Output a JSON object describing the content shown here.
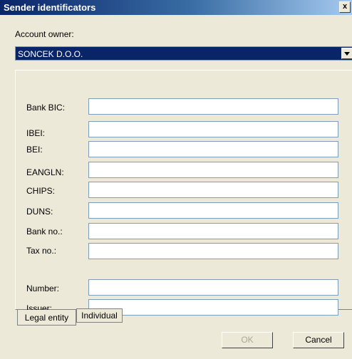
{
  "window": {
    "title": "Sender identificators",
    "close_glyph": "x"
  },
  "owner": {
    "label": "Account owner:",
    "selected": "SONCEK D.O.O."
  },
  "fields": [
    {
      "label": "Bank BIC:",
      "value": ""
    },
    {
      "label": "IBEI:",
      "value": ""
    },
    {
      "label": "BEI:",
      "value": ""
    },
    {
      "label": "EANGLN:",
      "value": ""
    },
    {
      "label": "CHIPS:",
      "value": ""
    },
    {
      "label": "DUNS:",
      "value": ""
    },
    {
      "label": "Bank no.:",
      "value": ""
    },
    {
      "label": "Tax no.:",
      "value": ""
    },
    {
      "label": "Number:",
      "value": ""
    },
    {
      "label": "Issuer:",
      "value": ""
    }
  ],
  "tabs": [
    {
      "label": "Legal entity",
      "active": true
    },
    {
      "label": "Individual",
      "active": false
    }
  ],
  "buttons": {
    "ok": "OK",
    "cancel": "Cancel"
  }
}
